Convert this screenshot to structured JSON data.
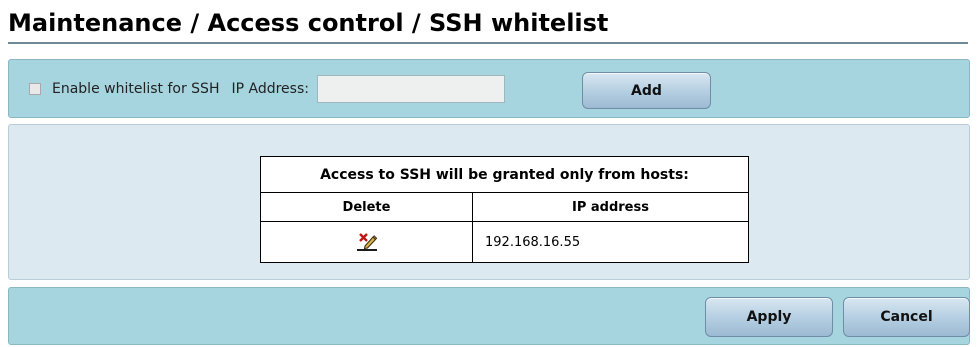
{
  "page": {
    "title": "Maintenance / Access control / SSH whitelist"
  },
  "whitelist_bar": {
    "enable_label": "Enable whitelist for SSH",
    "enable_checked": false,
    "ip_label": "IP Address:",
    "ip_value": "",
    "add_label": "Add"
  },
  "hosts_table": {
    "caption": "Access to SSH will be granted only from hosts:",
    "columns": [
      "Delete",
      "IP address"
    ],
    "rows": [
      {
        "ip": "192.168.16.55",
        "delete_icon": "delete-edit-icon"
      }
    ]
  },
  "footer": {
    "apply_label": "Apply",
    "cancel_label": "Cancel"
  },
  "colors": {
    "panel": "#a6d4df",
    "content": "#dde9f1",
    "button": "#b9d2e4"
  }
}
